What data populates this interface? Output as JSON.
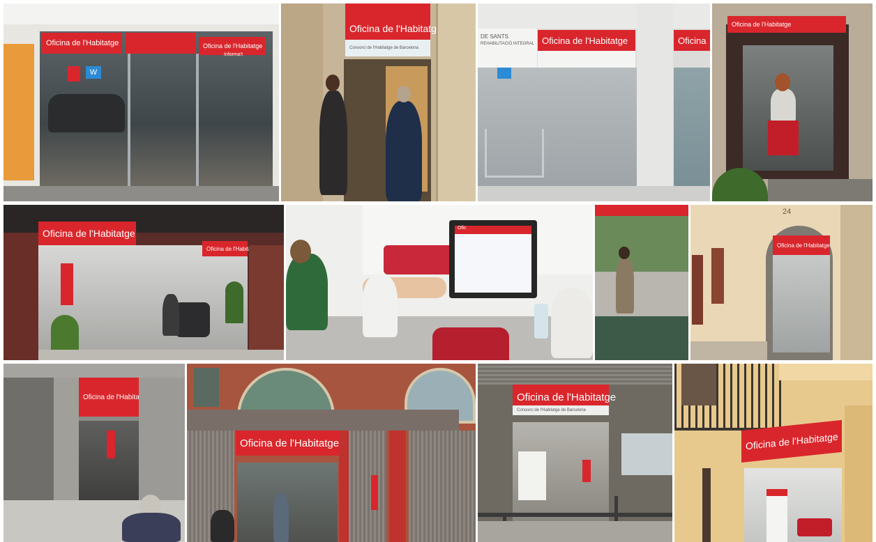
{
  "collage": {
    "sign_text": "Oficina de l'Habitatge",
    "sign_text_short": "Oficina",
    "informat_text": "Informa't",
    "consorci_text": "Consorci de l'Habitatge de Barcelona",
    "sants_line1": "DE SANTS",
    "sants_line2": "REHABILITACIÓ INTEGRAL",
    "building_number": "24",
    "monitor_header": "Ofic"
  },
  "colors": {
    "brand_red": "#d9262c",
    "stone_beige": "#d8c7a6",
    "glass_dark": "#4a5154",
    "brick": "#a7553f",
    "grey_concrete": "#9a9895"
  }
}
